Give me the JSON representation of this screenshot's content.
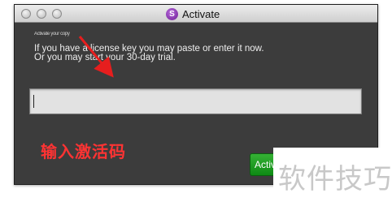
{
  "window": {
    "title": "Activate",
    "app_icon_glyph": "S",
    "app_icon_color": "#8a2fb8"
  },
  "content": {
    "heading_blurred": "Activate your copy",
    "line1": "If you have a license key you may paste or enter it now.",
    "line2": "Or you may start your 30-day trial.",
    "license_input_value": "",
    "license_input_placeholder": ""
  },
  "buttons": {
    "activate_label": "Activate",
    "activate_color": "#1a9a1f"
  },
  "annotation": {
    "text": "输入激活码",
    "color": "#ff3333"
  },
  "watermark": {
    "text": "软件技巧"
  }
}
